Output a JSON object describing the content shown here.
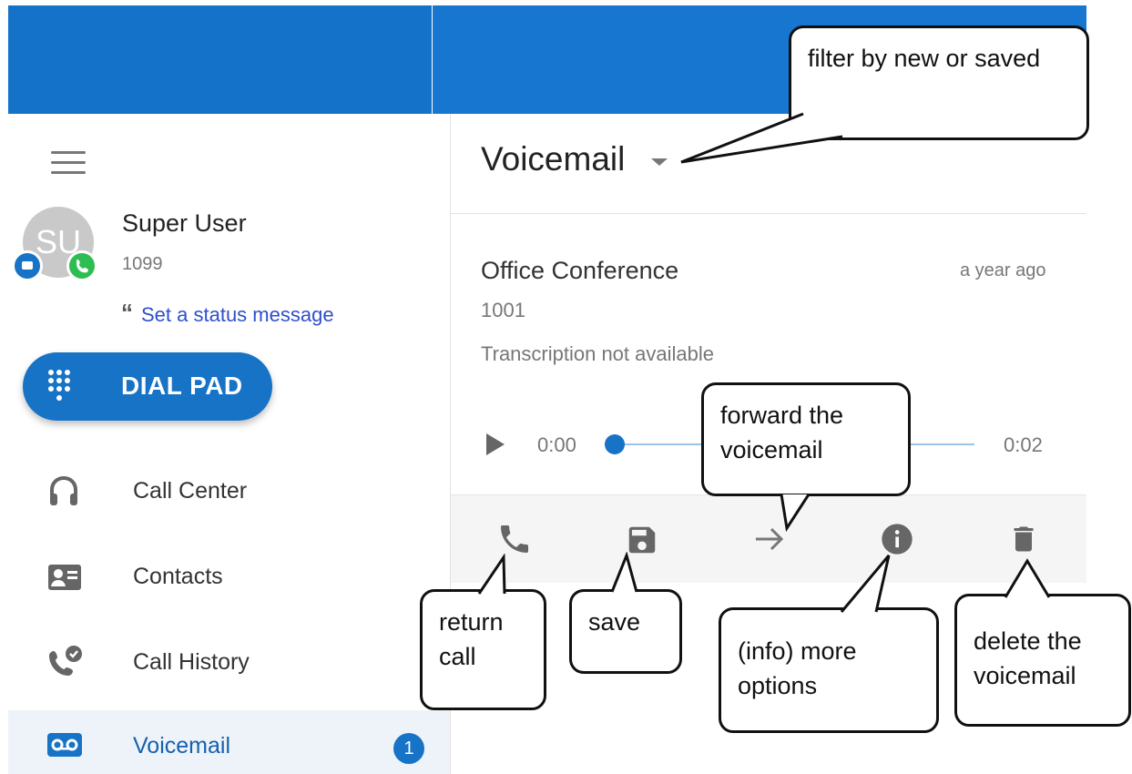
{
  "user": {
    "initials": "SU",
    "name": "Super User",
    "extension": "1099",
    "status_link": "Set a status message"
  },
  "dialpad": {
    "label": "DIAL PAD"
  },
  "nav": {
    "items": [
      {
        "label": "Call Center",
        "icon": "headset-icon"
      },
      {
        "label": "Contacts",
        "icon": "contact-card-icon"
      },
      {
        "label": "Call History",
        "icon": "call-history-icon"
      },
      {
        "label": "Voicemail",
        "icon": "voicemail-icon",
        "badge": "1",
        "active": true
      }
    ]
  },
  "main": {
    "title": "Voicemail",
    "voicemail": {
      "name": "Office Conference",
      "time": "a year ago",
      "number": "1001",
      "transcription": "Transcription not available",
      "position": "0:00",
      "duration": "0:02",
      "progress": 0
    },
    "actions": [
      {
        "icon": "phone-icon"
      },
      {
        "icon": "save-icon"
      },
      {
        "icon": "forward-arrow-icon"
      },
      {
        "icon": "info-icon"
      },
      {
        "icon": "trash-icon"
      }
    ]
  },
  "callouts": {
    "filter": "filter by new or saved",
    "forward": "forward the voicemail",
    "return_call": "return call",
    "save": "save",
    "info": "(info) more options",
    "delete": "delete the voicemail"
  },
  "colors": {
    "brand_blue": "#1773c6",
    "header_blue": "#1676d0",
    "link_blue": "#2f4fcc",
    "presence_green": "#2ebd52"
  }
}
